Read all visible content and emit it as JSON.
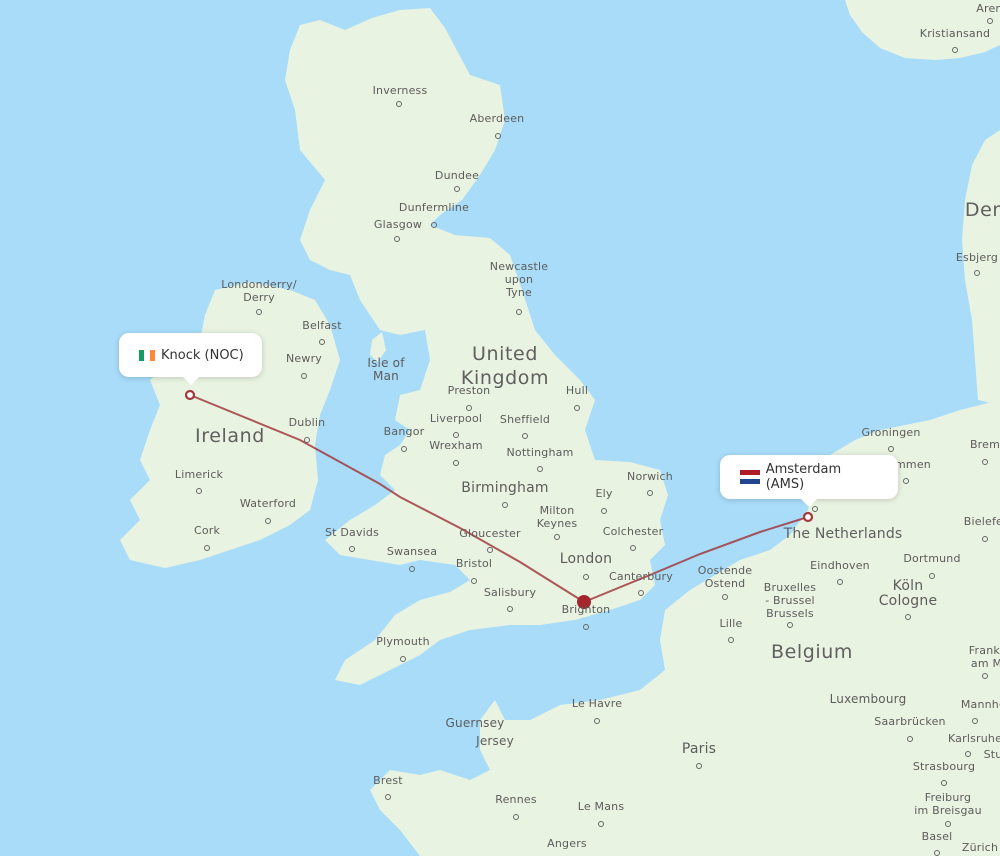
{
  "map": {
    "colors": {
      "water": "#a8dcf9",
      "land": "#e9f3e1",
      "route": "#a23a3f",
      "stopover": "#a3262d",
      "border": "#8ec98a"
    },
    "origin": {
      "name": "Knock (NOC)",
      "country_flag": "ireland-flag",
      "flag_colors": [
        "#169b62",
        "#ffffff",
        "#ff883e"
      ]
    },
    "destination": {
      "name": "Amsterdam (AMS)",
      "country_flag": "netherlands-flag",
      "flag_colors": [
        "#ae1c28",
        "#ffffff",
        "#21468b"
      ]
    },
    "stopover": {
      "description": "London area connection marker"
    },
    "countries": [
      {
        "id": "ireland",
        "label": "Ireland"
      },
      {
        "id": "uk",
        "label": "United\nKingdom"
      },
      {
        "id": "belgium",
        "label": "Belgium"
      },
      {
        "id": "netherlands",
        "label": "The Netherlands"
      },
      {
        "id": "denmark",
        "label": "Den"
      },
      {
        "id": "luxembourg",
        "label": "Luxembourg"
      }
    ],
    "regions": [
      {
        "id": "isle-of-man",
        "label": "Isle of\nMan"
      },
      {
        "id": "guernsey",
        "label": "Guernsey"
      },
      {
        "id": "jersey",
        "label": "Jersey"
      }
    ],
    "cities": [
      {
        "id": "inverness",
        "label": "Inverness"
      },
      {
        "id": "aberdeen",
        "label": "Aberdeen"
      },
      {
        "id": "dundee",
        "label": "Dundee"
      },
      {
        "id": "dunfermline",
        "label": "Dunfermline"
      },
      {
        "id": "glasgow",
        "label": "Glasgow"
      },
      {
        "id": "newcastle",
        "label": "Newcastle\nupon\nTyne"
      },
      {
        "id": "londonderry",
        "label": "Londonderry/\nDerry"
      },
      {
        "id": "belfast",
        "label": "Belfast"
      },
      {
        "id": "newry",
        "label": "Newry"
      },
      {
        "id": "dublin",
        "label": "Dublin"
      },
      {
        "id": "limerick",
        "label": "Limerick"
      },
      {
        "id": "waterford",
        "label": "Waterford"
      },
      {
        "id": "cork",
        "label": "Cork"
      },
      {
        "id": "preston",
        "label": "Preston"
      },
      {
        "id": "hull",
        "label": "Hull"
      },
      {
        "id": "liverpool",
        "label": "Liverpool"
      },
      {
        "id": "sheffield",
        "label": "Sheffield"
      },
      {
        "id": "bangor",
        "label": "Bangor"
      },
      {
        "id": "wrexham",
        "label": "Wrexham"
      },
      {
        "id": "nottingham",
        "label": "Nottingham"
      },
      {
        "id": "birmingham",
        "label": "Birmingham"
      },
      {
        "id": "norwich",
        "label": "Norwich"
      },
      {
        "id": "ely",
        "label": "Ely"
      },
      {
        "id": "milton-keynes",
        "label": "Milton\nKeynes"
      },
      {
        "id": "st-davids",
        "label": "St Davids"
      },
      {
        "id": "gloucester",
        "label": "Gloucester"
      },
      {
        "id": "colchester",
        "label": "Colchester"
      },
      {
        "id": "swansea",
        "label": "Swansea"
      },
      {
        "id": "bristol",
        "label": "Bristol"
      },
      {
        "id": "london",
        "label": "London"
      },
      {
        "id": "canterbury",
        "label": "Canterbury"
      },
      {
        "id": "salisbury",
        "label": "Salisbury"
      },
      {
        "id": "brighton",
        "label": "Brighton"
      },
      {
        "id": "plymouth",
        "label": "Plymouth"
      },
      {
        "id": "le-havre",
        "label": "Le Havre"
      },
      {
        "id": "paris",
        "label": "Paris"
      },
      {
        "id": "brest",
        "label": "Brest"
      },
      {
        "id": "rennes",
        "label": "Rennes"
      },
      {
        "id": "le-mans",
        "label": "Le Mans"
      },
      {
        "id": "angers",
        "label": "Angers"
      },
      {
        "id": "oostende",
        "label": "Oostende\nOstend"
      },
      {
        "id": "brussels",
        "label": "Bruxelles\n- Brussel\nBrussels"
      },
      {
        "id": "lille",
        "label": "Lille"
      },
      {
        "id": "eindhoven",
        "label": "Eindhoven"
      },
      {
        "id": "groningen",
        "label": "Groningen"
      },
      {
        "id": "emmen",
        "label": "mmen"
      },
      {
        "id": "bremen",
        "label": "Brem"
      },
      {
        "id": "bielefeld",
        "label": "Bielefel"
      },
      {
        "id": "dortmund",
        "label": "Dortmund"
      },
      {
        "id": "cologne",
        "label": "Köln\nCologne"
      },
      {
        "id": "frankfurt",
        "label": "Frankfu\nam Ma"
      },
      {
        "id": "mannheim",
        "label": "Mannhei"
      },
      {
        "id": "saarbrucken",
        "label": "Saarbrücken"
      },
      {
        "id": "karlsruhe",
        "label": "Karlsruhe"
      },
      {
        "id": "stuttgart",
        "label": "Stu"
      },
      {
        "id": "strasbourg",
        "label": "Strasbourg"
      },
      {
        "id": "freiburg",
        "label": "Freiburg\nim Breisgau"
      },
      {
        "id": "basel",
        "label": "Basel"
      },
      {
        "id": "zurich",
        "label": "Zürich"
      },
      {
        "id": "kristiansand",
        "label": "Kristiansand"
      },
      {
        "id": "arendal",
        "label": "Arend"
      },
      {
        "id": "esbjerg",
        "label": "Esbjerg"
      },
      {
        "id": "amsterdam-map",
        "label": "Amsterdam"
      }
    ]
  }
}
